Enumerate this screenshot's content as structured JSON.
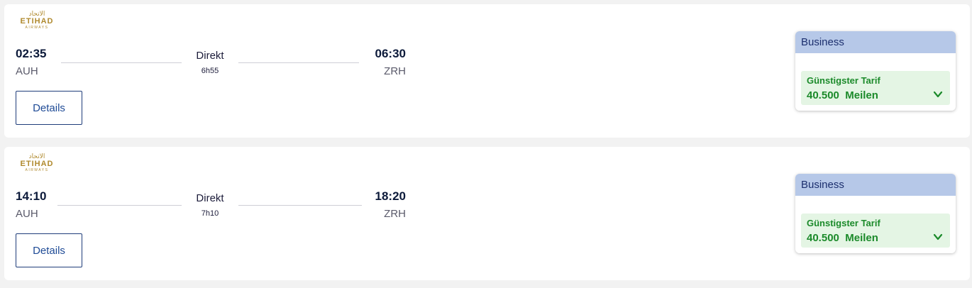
{
  "flights": [
    {
      "airline_logo": {
        "arabic": "الاتحاد",
        "word": "ETIHAD",
        "sub": "AIRWAYS"
      },
      "departure": {
        "time": "02:35",
        "code": "AUH"
      },
      "stops": "Direkt",
      "duration": "6h55",
      "arrival": {
        "time": "06:30",
        "code": "ZRH"
      },
      "details_label": "Details",
      "fare": {
        "cabin": "Business",
        "label": "Günstigster Tarif",
        "price": "40.500",
        "unit": "Meilen",
        "icon": "chevron-down-icon"
      }
    },
    {
      "airline_logo": {
        "arabic": "الاتحاد",
        "word": "ETIHAD",
        "sub": "AIRWAYS"
      },
      "departure": {
        "time": "14:10",
        "code": "AUH"
      },
      "stops": "Direkt",
      "duration": "7h10",
      "arrival": {
        "time": "18:20",
        "code": "ZRH"
      },
      "details_label": "Details",
      "fare": {
        "cabin": "Business",
        "label": "Günstigster Tarif",
        "price": "40.500",
        "unit": "Meilen",
        "icon": "chevron-down-icon"
      }
    }
  ],
  "colors": {
    "brand_gold": "#b08a2e",
    "fare_green": "#1b8a2a",
    "cabin_header": "#b6c8e8",
    "link_blue": "#1f4b96"
  }
}
